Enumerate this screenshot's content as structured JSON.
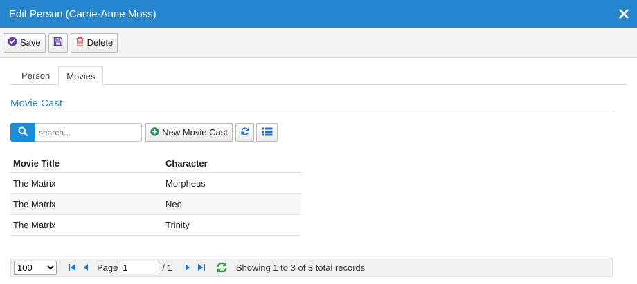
{
  "dialog": {
    "title": "Edit Person (Carrie-Anne Moss)"
  },
  "toolbar": {
    "save_label": "Save",
    "delete_label": "Delete"
  },
  "tabs": [
    {
      "label": "Person"
    },
    {
      "label": "Movies",
      "active": true
    }
  ],
  "section": {
    "title": "Movie Cast"
  },
  "search": {
    "placeholder": "search...",
    "value": ""
  },
  "grid_toolbar": {
    "new_label": "New Movie Cast"
  },
  "table": {
    "columns": [
      "Movie Title",
      "Character"
    ],
    "rows": [
      [
        "The Matrix",
        "Morpheus"
      ],
      [
        "The Matrix",
        "Neo"
      ],
      [
        "The Matrix",
        "Trinity"
      ]
    ]
  },
  "pager": {
    "page_size": "100",
    "page_size_options": [
      "100"
    ],
    "page_label": "Page",
    "page_value": "1",
    "page_total": "/ 1",
    "status": "Showing 1 to 3 of 3 total records"
  },
  "colors": {
    "header": "#2585cf",
    "accent": "#1a8cd8",
    "icon_purple": "#6a3fb5",
    "icon_red": "#d9534f",
    "icon_green": "#2e8b57"
  }
}
